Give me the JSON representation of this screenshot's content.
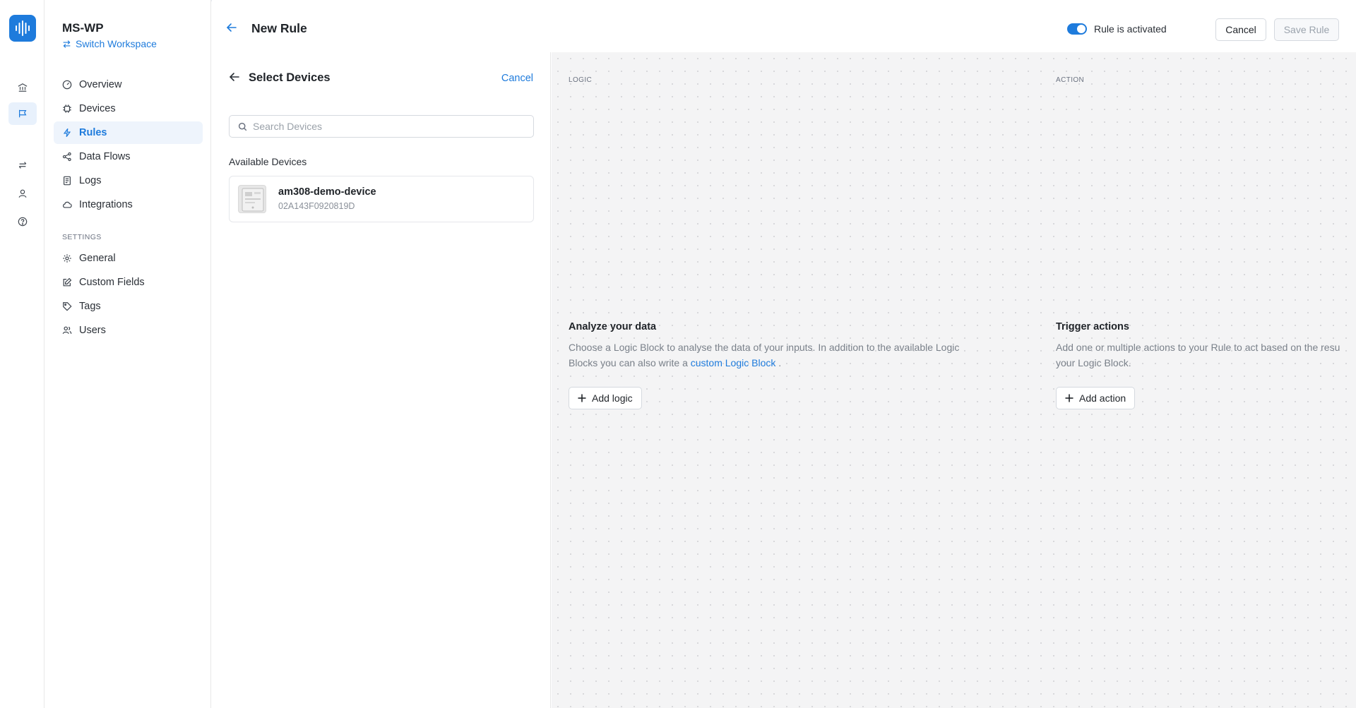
{
  "workspace": {
    "name": "MS-WP",
    "switch_label": "Switch Workspace"
  },
  "nav": {
    "items": [
      {
        "label": "Overview",
        "icon": "gauge-icon"
      },
      {
        "label": "Devices",
        "icon": "chip-icon"
      },
      {
        "label": "Rules",
        "icon": "lightning-icon",
        "active": true
      },
      {
        "label": "Data Flows",
        "icon": "share-icon"
      },
      {
        "label": "Logs",
        "icon": "log-icon"
      },
      {
        "label": "Integrations",
        "icon": "cloud-icon"
      }
    ],
    "settings_heading": "SETTINGS",
    "settings_items": [
      {
        "label": "General",
        "icon": "gear-icon"
      },
      {
        "label": "Custom Fields",
        "icon": "edit-icon"
      },
      {
        "label": "Tags",
        "icon": "tag-icon"
      },
      {
        "label": "Users",
        "icon": "users-icon"
      }
    ]
  },
  "header": {
    "title": "New Rule",
    "toggle_label": "Rule is activated",
    "toggle_on": true,
    "cancel_label": "Cancel",
    "save_label": "Save Rule"
  },
  "panel": {
    "title": "Select Devices",
    "cancel_label": "Cancel",
    "search_placeholder": "Search Devices",
    "available_label": "Available Devices",
    "devices": [
      {
        "name": "am308-demo-device",
        "id": "02A143F0920819D"
      }
    ]
  },
  "canvas": {
    "logic": {
      "label": "LOGIC",
      "title": "Analyze your data",
      "desc_1": "Choose a Logic Block to analyse the data of your inputs. In addition to the available Logic",
      "desc_2": "Blocks you can also write a",
      "link": "custom Logic Block",
      "desc_3": ".",
      "button": "Add logic"
    },
    "action": {
      "label": "ACTION",
      "title": "Trigger actions",
      "desc_1": "Add one or multiple actions to your Rule to act based on the resu",
      "desc_2": "your Logic Block.",
      "button": "Add action"
    }
  },
  "colors": {
    "accent": "#1e7bdc",
    "annotation_arrow": "#e8202a",
    "canvas_bg": "#f4f4f5"
  }
}
